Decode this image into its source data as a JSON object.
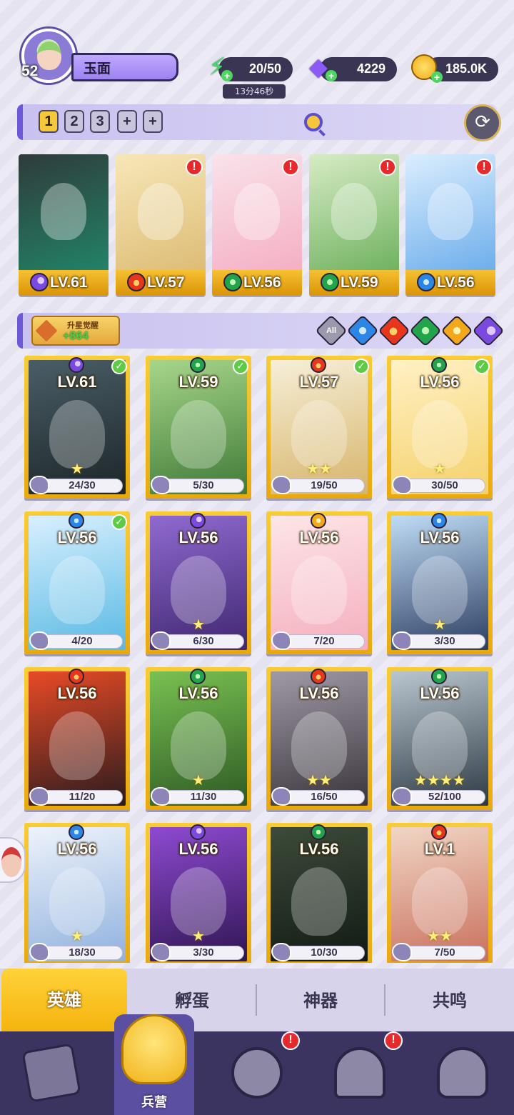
{
  "player": {
    "level": "52",
    "name": "玉面"
  },
  "resources": {
    "energy": "20/50",
    "energy_timer": "13分46秒",
    "gems": "4229",
    "gold": "185.0K"
  },
  "team": {
    "slots": [
      "1",
      "2",
      "3",
      "+",
      "+"
    ],
    "active_slot": "1",
    "members": [
      {
        "level": "LV.61",
        "element": "dark",
        "alert": false,
        "colors": [
          "#2f3b3a",
          "#1f8f6f"
        ]
      },
      {
        "level": "LV.57",
        "element": "fire",
        "alert": true,
        "colors": [
          "#f7e7b8",
          "#d9b56a"
        ]
      },
      {
        "level": "LV.56",
        "element": "wind",
        "alert": true,
        "colors": [
          "#f9e3ea",
          "#f4a6bd"
        ]
      },
      {
        "level": "LV.59",
        "element": "wind",
        "alert": true,
        "colors": [
          "#d7ecc5",
          "#5ea84e"
        ]
      },
      {
        "level": "LV.56",
        "element": "water",
        "alert": true,
        "colors": [
          "#dbeefe",
          "#5aa3e8"
        ]
      }
    ]
  },
  "filter": {
    "awaken_label": "升星觉醒",
    "awaken_count": "+864",
    "all_label": "All",
    "elements": [
      "water",
      "fire",
      "wind",
      "light",
      "dark"
    ]
  },
  "heroes": [
    {
      "level": "LV.61",
      "element": "dark",
      "shards": "24/30",
      "checked": true,
      "stars": 1,
      "colors": [
        "#4a5d66",
        "#1c2628"
      ]
    },
    {
      "level": "LV.59",
      "element": "wind",
      "shards": "5/30",
      "checked": true,
      "stars": 0,
      "colors": [
        "#a7d68a",
        "#3f7a37"
      ]
    },
    {
      "level": "LV.57",
      "element": "fire",
      "shards": "19/50",
      "checked": true,
      "stars": 2,
      "colors": [
        "#f6efd9",
        "#d7b46a"
      ]
    },
    {
      "level": "LV.56",
      "element": "wind",
      "shards": "30/50",
      "checked": true,
      "stars": 1,
      "colors": [
        "#fff1c5",
        "#f5d16a"
      ]
    },
    {
      "level": "LV.56",
      "element": "water",
      "shards": "4/20",
      "checked": true,
      "stars": 0,
      "colors": [
        "#d9f0ff",
        "#58b9e3"
      ]
    },
    {
      "level": "LV.56",
      "element": "dark",
      "shards": "6/30",
      "checked": false,
      "stars": 1,
      "colors": [
        "#8f6ad0",
        "#3f2770"
      ]
    },
    {
      "level": "LV.56",
      "element": "light",
      "shards": "7/20",
      "checked": false,
      "stars": 0,
      "colors": [
        "#fde6e8",
        "#f4aebd"
      ]
    },
    {
      "level": "LV.56",
      "element": "water",
      "shards": "3/30",
      "checked": false,
      "stars": 1,
      "colors": [
        "#bfdcf5",
        "#2c3e62"
      ]
    },
    {
      "level": "LV.56",
      "element": "fire",
      "shards": "11/20",
      "checked": false,
      "stars": 0,
      "colors": [
        "#e84a26",
        "#2a1b1e"
      ]
    },
    {
      "level": "LV.56",
      "element": "wind",
      "shards": "11/30",
      "checked": false,
      "stars": 1,
      "colors": [
        "#79c152",
        "#2e5a24"
      ]
    },
    {
      "level": "LV.56",
      "element": "fire",
      "shards": "16/50",
      "checked": false,
      "stars": 2,
      "colors": [
        "#9f9aa6",
        "#3a343c"
      ]
    },
    {
      "level": "LV.56",
      "element": "wind",
      "shards": "52/100",
      "checked": false,
      "stars": 4,
      "colors": [
        "#b9c6cf",
        "#2d3a44"
      ]
    },
    {
      "level": "LV.56",
      "element": "water",
      "shards": "18/30",
      "checked": false,
      "stars": 1,
      "colors": [
        "#eef3fb",
        "#8fb1de"
      ]
    },
    {
      "level": "LV.56",
      "element": "dark",
      "shards": "3/30",
      "checked": false,
      "stars": 1,
      "colors": [
        "#8e4ad1",
        "#2f1552"
      ]
    },
    {
      "level": "LV.56",
      "element": "wind",
      "shards": "10/30",
      "checked": false,
      "stars": 0,
      "colors": [
        "#3d4b3a",
        "#111a14"
      ]
    },
    {
      "level": "LV.1",
      "element": "fire",
      "shards": "7/50",
      "checked": false,
      "stars": 2,
      "colors": [
        "#f1d6c6",
        "#c9705c"
      ]
    }
  ],
  "tabs": [
    "英雄",
    "孵蛋",
    "神器",
    "共鸣"
  ],
  "active_tab": "英雄",
  "nav": {
    "barracks_label": "兵营",
    "items": [
      "cards-icon",
      "barracks-icon",
      "map-icon",
      "shop-icon",
      "mage-icon"
    ],
    "alerts": [
      "map-icon",
      "shop-icon"
    ]
  },
  "colors": {
    "accent": "#6f58d8",
    "card_gold": "#f8cc35",
    "nav_bg": "#3b3460",
    "alert_red": "#e8292c"
  }
}
